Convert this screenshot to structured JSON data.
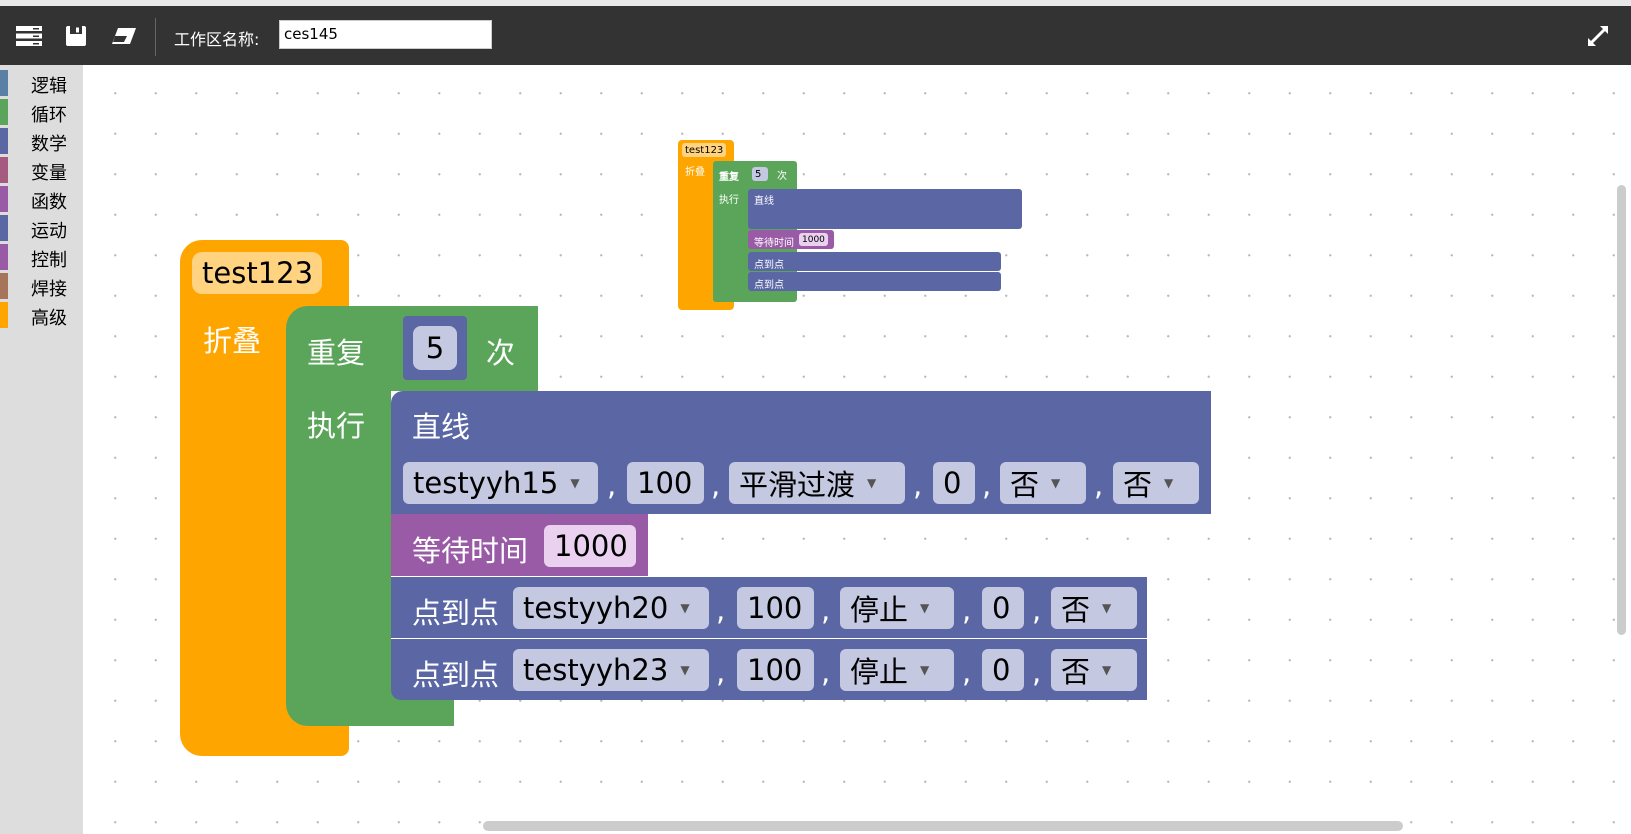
{
  "toolbar": {
    "workspace_label": "工作区名称:",
    "workspace_name": "ces145"
  },
  "sidebar": {
    "items": [
      {
        "label": "逻辑",
        "color": "#5b80a5"
      },
      {
        "label": "循环",
        "color": "#5ba55b"
      },
      {
        "label": "数学",
        "color": "#5b67a5"
      },
      {
        "label": "变量",
        "color": "#a55b80"
      },
      {
        "label": "函数",
        "color": "#995ba5"
      },
      {
        "label": "运动",
        "color": "#5b67a5"
      },
      {
        "label": "控制",
        "color": "#995ba5"
      },
      {
        "label": "焊接",
        "color": "#a5745b"
      },
      {
        "label": "高级",
        "color": "#ffa500"
      }
    ]
  },
  "blocks": {
    "function": {
      "name": "test123",
      "body_label": "折叠",
      "color": "#ffa500"
    },
    "repeat": {
      "label": "重复",
      "count": "5",
      "unit": "次",
      "do_label": "执行",
      "color": "#5ba55b"
    },
    "line": {
      "title": "直线",
      "point": "testyyh15",
      "speed": "100",
      "mode": "平滑过渡",
      "zone": "0",
      "opt1": "否",
      "opt2": "否",
      "color": "#5b67a5"
    },
    "wait": {
      "label": "等待时间",
      "value": "1000",
      "color": "#995ba5"
    },
    "ptp1": {
      "label": "点到点",
      "point": "testyyh20",
      "speed": "100",
      "mode": "停止",
      "zone": "0",
      "opt": "否"
    },
    "ptp2": {
      "label": "点到点",
      "point": "testyyh23",
      "speed": "100",
      "mode": "停止",
      "zone": "0",
      "opt": "否"
    }
  },
  "comma": ","
}
